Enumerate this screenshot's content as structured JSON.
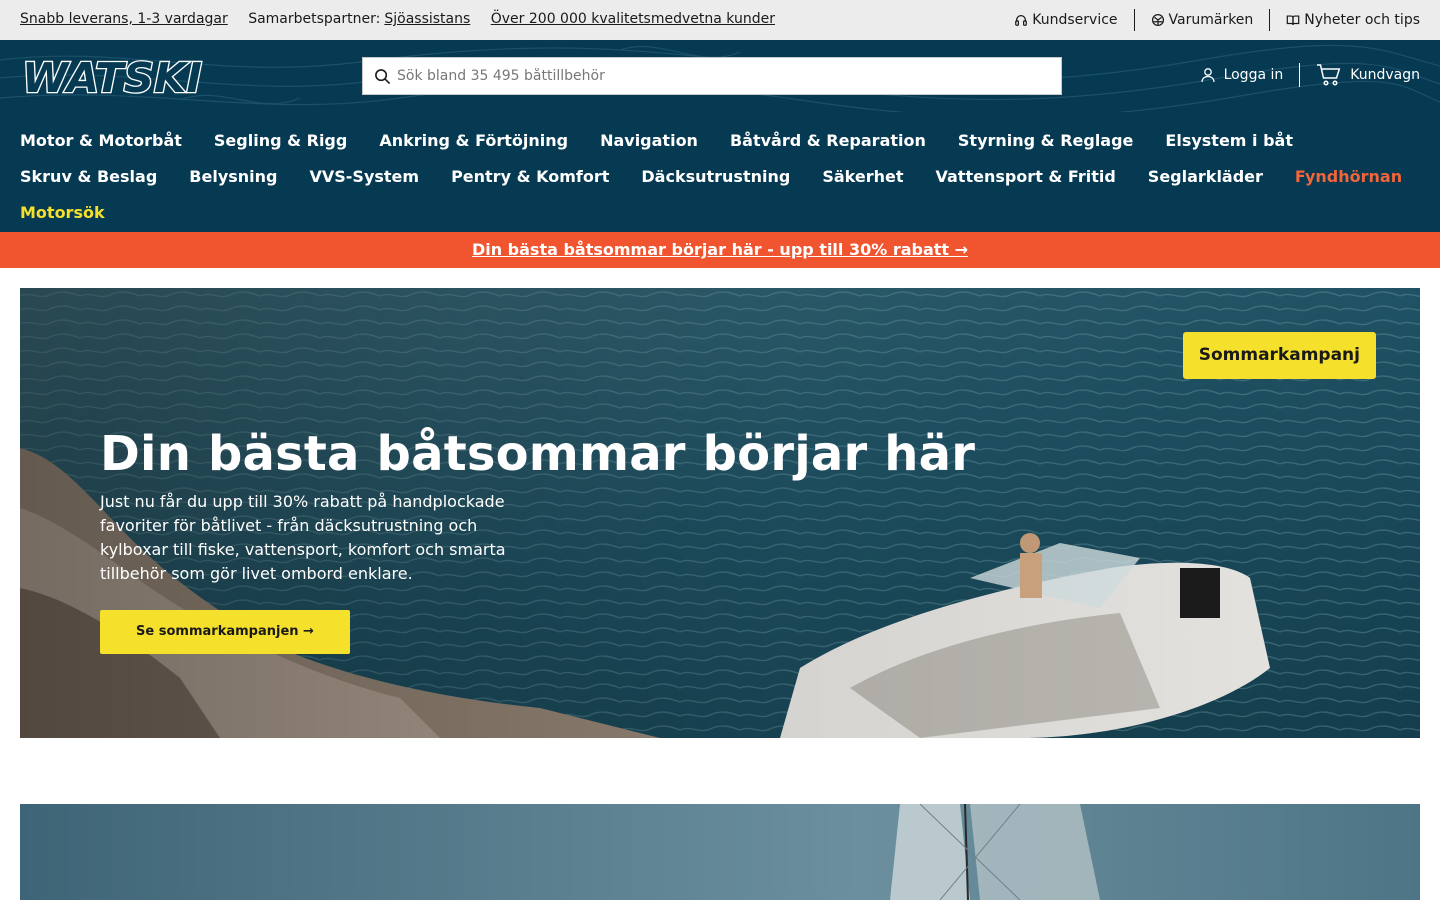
{
  "topbar": {
    "delivery": "Snabb leverans, 1-3 vardagar",
    "partner_label": "Samarbetspartner:",
    "partner_link": "Sjöassistans",
    "customers": "Över 200 000 kvalitetsmedvetna kunder",
    "customer_service": "Kundservice",
    "brands": "Varumärken",
    "news": "Nyheter och tips"
  },
  "header": {
    "logo": "WATSKI",
    "search_placeholder": "Sök bland 35 495 båttillbehör",
    "login": "Logga in",
    "cart": "Kundvagn"
  },
  "nav": {
    "row1": [
      "Motor & Motorbåt",
      "Segling & Rigg",
      "Ankring & Förtöjning",
      "Navigation",
      "Båtvård & Reparation",
      "Styrning & Reglage",
      "Elsystem i båt"
    ],
    "row2": [
      "Skruv & Beslag",
      "Belysning",
      "VVS-System",
      "Pentry & Komfort",
      "Däcksutrustning",
      "Säkerhet",
      "Vattensport & Fritid",
      "Seglarkläder",
      "Fyndhörnan"
    ],
    "row3": [
      "Motorsök"
    ]
  },
  "promo": {
    "text": "Din bästa båtsommar börjar här - upp till 30% rabatt →"
  },
  "hero": {
    "badge": "Sommarkampanj",
    "title": "Din bästa båtsommar börjar här",
    "text": "Just nu får du upp till 30% rabatt på handplockade favoriter för båtlivet - från däcksutrustning och kylboxar till fiske, vattensport, komfort och smarta tillbehör som gör livet ombord enklare.",
    "cta": "Se sommarkampanjen →"
  },
  "colors": {
    "header_bg": "#053a52",
    "accent_yellow": "#f5e02b",
    "promo_orange": "#f0552f",
    "sale_red": "#f2643a"
  },
  "icons": [
    "headset-icon",
    "brands-icon",
    "book-icon",
    "search-icon",
    "user-icon",
    "cart-icon"
  ]
}
